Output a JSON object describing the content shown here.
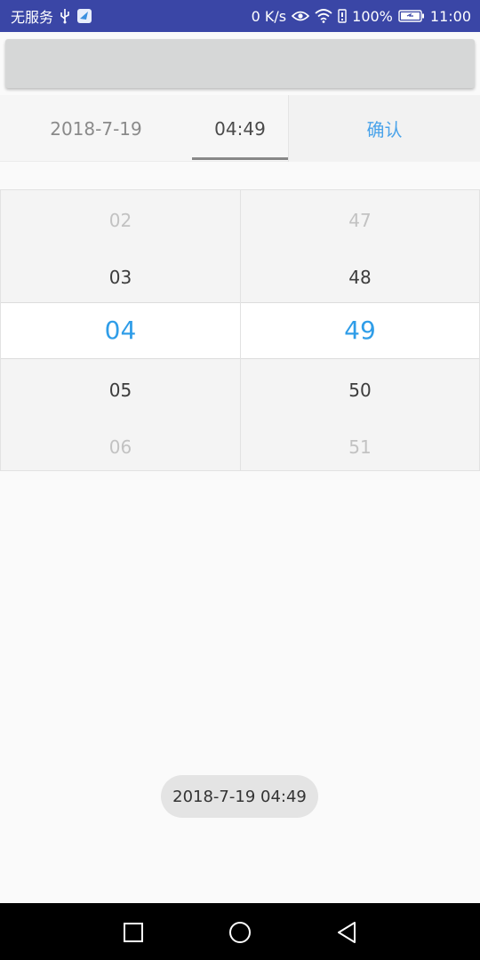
{
  "status_bar": {
    "carrier": "无服务",
    "speed": "0 K/s",
    "battery": "100%",
    "time": "11:00",
    "icons": [
      "usb-icon",
      "app-icon",
      "eye-icon",
      "wifi-icon",
      "signal-icon",
      "battery-icon"
    ]
  },
  "tabs": {
    "date": "2018-7-19",
    "time": "04:49",
    "confirm": "确认"
  },
  "picker": {
    "hours": {
      "items": [
        "02",
        "03",
        "04",
        "05",
        "06"
      ],
      "selected": "04"
    },
    "minutes": {
      "items": [
        "47",
        "48",
        "49",
        "50",
        "51"
      ],
      "selected": "49"
    }
  },
  "toast": {
    "text": "2018-7-19 04:49"
  },
  "nav": {
    "icons": [
      "recent-apps-icon",
      "home-icon",
      "back-icon"
    ]
  },
  "colors": {
    "status_bar": "#3a46a6",
    "accent": "#2f9de8",
    "confirm": "#4aa3ea"
  }
}
